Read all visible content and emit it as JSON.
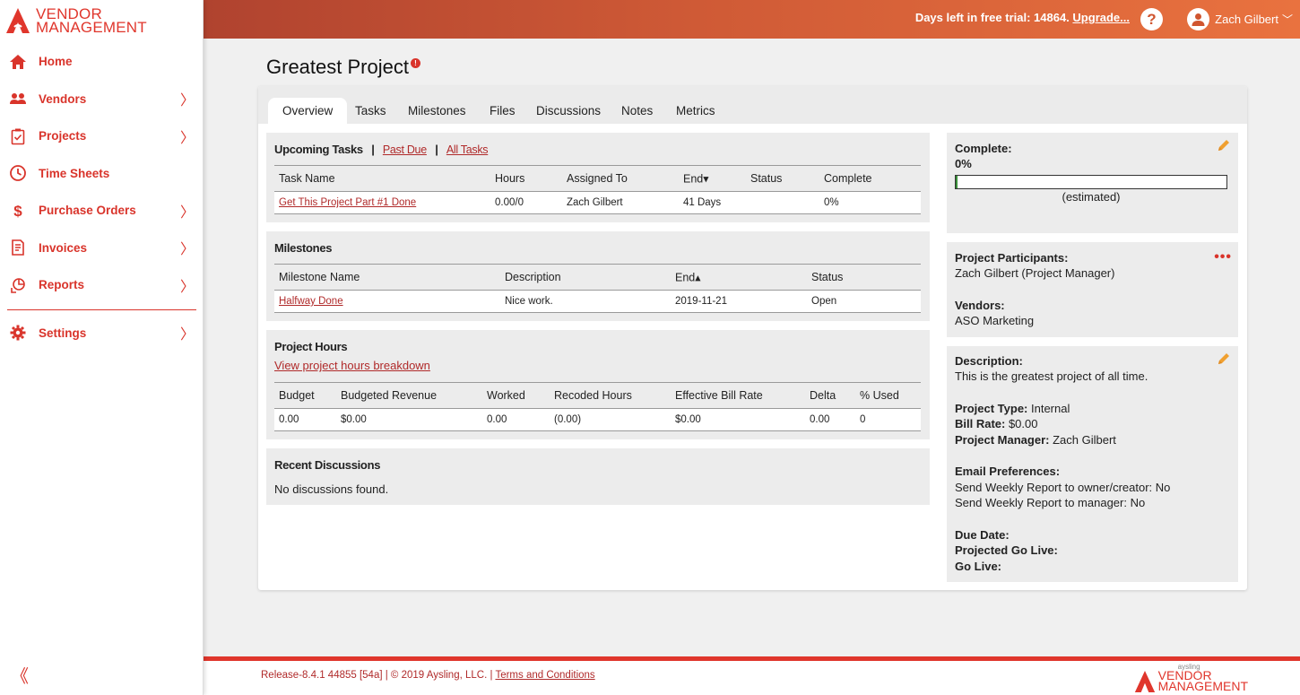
{
  "brand": {
    "line1": "VENDOR",
    "line2": "MANAGEMENT",
    "color": "#e0362c",
    "small": "aysling"
  },
  "sidebar": {
    "items": [
      {
        "label": "Home",
        "icon": "home-icon",
        "has_submenu": false
      },
      {
        "label": "Vendors",
        "icon": "users-icon",
        "has_submenu": true
      },
      {
        "label": "Projects",
        "icon": "clipboard-check-icon",
        "has_submenu": true
      },
      {
        "label": "Time Sheets",
        "icon": "clock-icon",
        "has_submenu": false
      },
      {
        "label": "Purchase Orders",
        "icon": "dollar-icon",
        "has_submenu": true
      },
      {
        "label": "Invoices",
        "icon": "invoice-icon",
        "has_submenu": true
      },
      {
        "label": "Reports",
        "icon": "reports-icon",
        "has_submenu": true
      }
    ],
    "settings": {
      "label": "Settings",
      "icon": "gear-icon",
      "has_submenu": true
    },
    "chevron": "〉",
    "collapse": "《"
  },
  "topbar": {
    "trial_text": "Days left in free trial: 14864.",
    "upgrade_label": "Upgrade...",
    "help_label": "?",
    "user_name": "Zach Gilbert",
    "user_chevron": "﹀"
  },
  "page": {
    "title": "Greatest Project",
    "info_badge": "!"
  },
  "tabs": [
    "Overview",
    "Tasks",
    "Milestones",
    "Files",
    "Discussions",
    "Notes",
    "Metrics"
  ],
  "upcoming_tasks": {
    "title": "Upcoming Tasks",
    "sep": "|",
    "past_due": "Past Due",
    "all_tasks": "All Tasks",
    "headers": [
      "Task Name",
      "Hours",
      "Assigned To",
      "End▾",
      "Status",
      "Complete"
    ],
    "rows": [
      [
        "Get This Project Part #1 Done",
        "0.00/0",
        "Zach Gilbert",
        "41 Days",
        "",
        "0%"
      ]
    ]
  },
  "milestones": {
    "title": "Milestones",
    "headers": [
      "Milestone Name",
      "Description",
      "End▴",
      "Status"
    ],
    "rows": [
      [
        "Halfway Done",
        "Nice work.",
        "2019-11-21",
        "Open"
      ]
    ]
  },
  "project_hours": {
    "title": "Project Hours",
    "breakdown_link": "View project hours breakdown",
    "headers": [
      "Budget",
      "Budgeted Revenue",
      "Worked",
      "Recoded Hours",
      "Effective Bill Rate",
      "Delta",
      "% Used"
    ],
    "rows": [
      [
        "0.00",
        "$0.00",
        "0.00",
        "(0.00)",
        "$0.00",
        "0.00",
        "0"
      ]
    ]
  },
  "recent_discussions": {
    "title": "Recent Discussions",
    "empty": "No discussions found."
  },
  "complete": {
    "label": "Complete:",
    "value": "0%",
    "progress": 0.0,
    "note": "(estimated)",
    "bar_color": "#3a8f3a"
  },
  "participants": {
    "label": "Project Participants:",
    "value": "Zach Gilbert (Project Manager)",
    "vendors_label": "Vendors:",
    "vendors_value": "ASO Marketing",
    "menu": "•••"
  },
  "details": {
    "desc_label": "Description:",
    "desc_value": "This is the greatest project of all time.",
    "type_label": "Project Type:",
    "type_value": " Internal",
    "rate_label": "Bill Rate:",
    "rate_value": " $0.00",
    "pm_label": "Project Manager:",
    "pm_value": " Zach Gilbert",
    "email_label": "Email Preferences:",
    "email_owner": "Send Weekly Report to owner/creator: No",
    "email_manager": "Send Weekly Report to manager: No",
    "due_label": "Due Date:",
    "golive_proj_label": "Projected Go Live:",
    "golive_label": "Go Live:"
  },
  "footer": {
    "text": "Release-8.4.1 44855 [54a] | © 2019 Aysling, LLC. | ",
    "terms": "Terms and Conditions"
  }
}
